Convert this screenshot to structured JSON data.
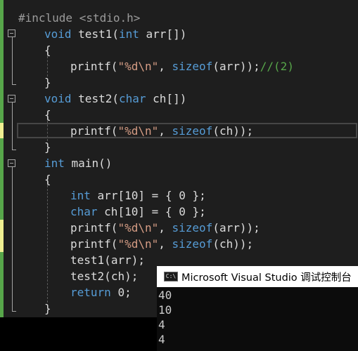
{
  "editor": {
    "lines": [
      "#include <stdio.h>",
      "void test1(int arr[])",
      "{",
      "printf(\"%d\\n\", sizeof(arr));//(2)",
      "}",
      "void test2(char ch[])",
      "{",
      "printf(\"%d\\n\", sizeof(ch));",
      "}",
      "int main()",
      "{",
      "int arr[10] = { 0 };",
      "char ch[10] = { 0 };",
      "printf(\"%d\\n\", sizeof(arr));",
      "printf(\"%d\\n\", sizeof(ch));",
      "test1(arr);",
      "test2(ch);",
      "return 0;",
      "}"
    ]
  },
  "console": {
    "icon_label": "C:\\",
    "title": "Microsoft Visual Studio 调试控制台",
    "output": [
      "40",
      "10",
      "4",
      "4"
    ]
  },
  "colors": {
    "editor_bg": "#1e1e1e",
    "keyword": "#569cd6",
    "string": "#d69d85",
    "comment": "#57a64a",
    "preprocessor": "#9b9b9b",
    "text": "#dcdcdc",
    "change_bar_saved": "#57a64a",
    "change_bar_unsaved": "#efef91"
  }
}
